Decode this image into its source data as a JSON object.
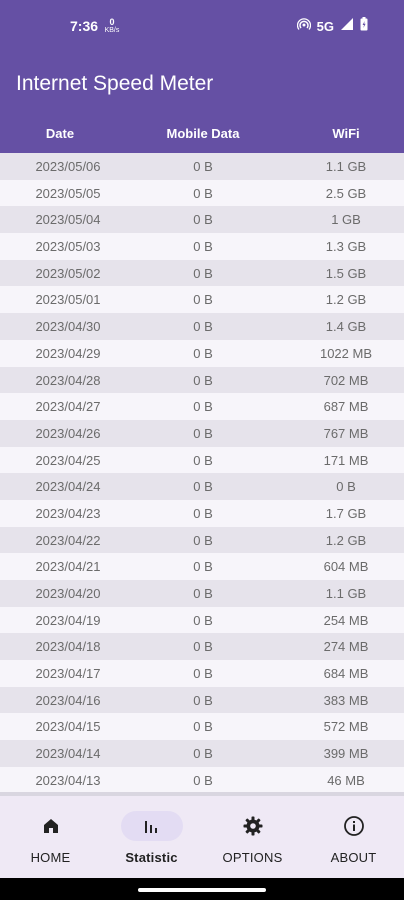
{
  "status_bar": {
    "time": "7:36",
    "net_speed_value": "0",
    "net_speed_unit": "KB/s",
    "network": "5G"
  },
  "app": {
    "title": "Internet Speed Meter"
  },
  "table": {
    "headers": {
      "date": "Date",
      "mobile": "Mobile Data",
      "wifi": "WiFi"
    },
    "rows": [
      {
        "date": "2023/05/06",
        "mobile": "0 B",
        "wifi": "1.1 GB"
      },
      {
        "date": "2023/05/05",
        "mobile": "0 B",
        "wifi": "2.5 GB"
      },
      {
        "date": "2023/05/04",
        "mobile": "0 B",
        "wifi": "1 GB"
      },
      {
        "date": "2023/05/03",
        "mobile": "0 B",
        "wifi": "1.3 GB"
      },
      {
        "date": "2023/05/02",
        "mobile": "0 B",
        "wifi": "1.5 GB"
      },
      {
        "date": "2023/05/01",
        "mobile": "0 B",
        "wifi": "1.2 GB"
      },
      {
        "date": "2023/04/30",
        "mobile": "0 B",
        "wifi": "1.4 GB"
      },
      {
        "date": "2023/04/29",
        "mobile": "0 B",
        "wifi": "1022 MB"
      },
      {
        "date": "2023/04/28",
        "mobile": "0 B",
        "wifi": "702 MB"
      },
      {
        "date": "2023/04/27",
        "mobile": "0 B",
        "wifi": "687 MB"
      },
      {
        "date": "2023/04/26",
        "mobile": "0 B",
        "wifi": "767 MB"
      },
      {
        "date": "2023/04/25",
        "mobile": "0 B",
        "wifi": "171 MB"
      },
      {
        "date": "2023/04/24",
        "mobile": "0 B",
        "wifi": "0 B"
      },
      {
        "date": "2023/04/23",
        "mobile": "0 B",
        "wifi": "1.7 GB"
      },
      {
        "date": "2023/04/22",
        "mobile": "0 B",
        "wifi": "1.2 GB"
      },
      {
        "date": "2023/04/21",
        "mobile": "0 B",
        "wifi": "604 MB"
      },
      {
        "date": "2023/04/20",
        "mobile": "0 B",
        "wifi": "1.1 GB"
      },
      {
        "date": "2023/04/19",
        "mobile": "0 B",
        "wifi": "254 MB"
      },
      {
        "date": "2023/04/18",
        "mobile": "0 B",
        "wifi": "274 MB"
      },
      {
        "date": "2023/04/17",
        "mobile": "0 B",
        "wifi": "684 MB"
      },
      {
        "date": "2023/04/16",
        "mobile": "0 B",
        "wifi": "383 MB"
      },
      {
        "date": "2023/04/15",
        "mobile": "0 B",
        "wifi": "572 MB"
      },
      {
        "date": "2023/04/14",
        "mobile": "0 B",
        "wifi": "399 MB"
      },
      {
        "date": "2023/04/13",
        "mobile": "0 B",
        "wifi": "46 MB"
      }
    ]
  },
  "nav": {
    "items": [
      {
        "label": "HOME",
        "icon": "home-icon",
        "active": false
      },
      {
        "label": "Statistic",
        "icon": "bar-chart-icon",
        "active": true
      },
      {
        "label": "OPTIONS",
        "icon": "gear-icon",
        "active": false
      },
      {
        "label": "ABOUT",
        "icon": "info-icon",
        "active": false
      }
    ]
  },
  "colors": {
    "primary": "#6550a4",
    "row_odd": "#e6e3eb",
    "row_even": "#f7f5fa",
    "nav_bg": "#efe9f5",
    "nav_active_pill": "#e3dcf3"
  }
}
